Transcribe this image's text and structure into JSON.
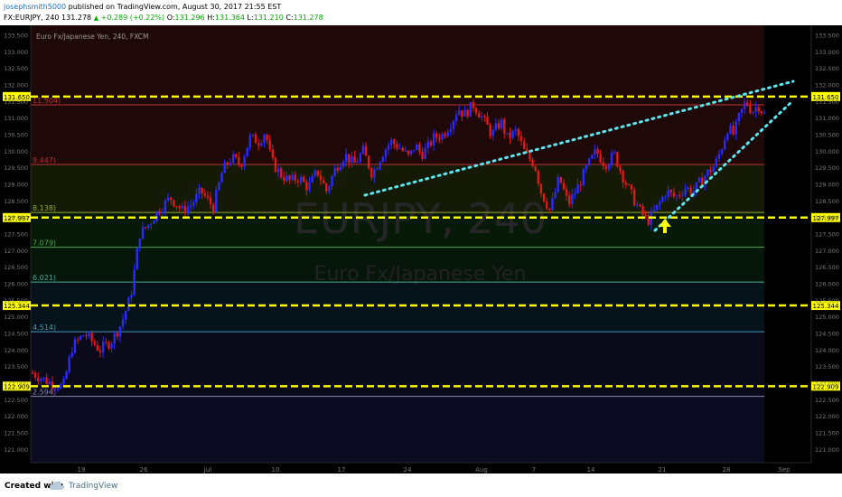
{
  "header": {
    "author": "josephsmith5000",
    "published_text": "published on TradingView.com, August 30, 2017 21:55 EST",
    "symbol": "FX:EURJPY, 240",
    "price": "131.278",
    "change": "+0.289 (+0.22%)",
    "o_label": "O:",
    "o_value": "131.296",
    "h_label": "H:",
    "h_value": "131.364",
    "l_label": "L:",
    "l_value": "131.210",
    "c_label": "C:",
    "c_value": "131.278"
  },
  "chart": {
    "title_label": "Euro Fx/Japanese Yen, 240, FXCM",
    "watermark_big": "EURJPY, 240",
    "watermark_small": "Euro Fx/Japanese Yen"
  },
  "footer": {
    "created_with": "Created with",
    "brand": "TradingView"
  },
  "colors": {
    "background": "#000000",
    "bull": "#2a2aff",
    "bear": "#e01818",
    "level_line": "#ffff00",
    "trend_line": "#5ee6f0"
  },
  "chart_data": {
    "type": "candlestick",
    "ylim": [
      120.6,
      133.8
    ],
    "y_ticks": [
      121.0,
      121.5,
      122.0,
      122.5,
      123.0,
      123.5,
      124.0,
      124.5,
      125.0,
      125.5,
      126.0,
      126.5,
      127.0,
      127.5,
      128.0,
      128.5,
      129.0,
      129.5,
      130.0,
      130.5,
      131.0,
      131.5,
      132.0,
      132.5,
      133.0,
      133.5
    ],
    "x_ticks": [
      "19",
      "26",
      "Jul",
      "10",
      "17",
      "24",
      "Aug",
      "7",
      "14",
      "21",
      "28",
      "Sep"
    ],
    "price_path": [
      [
        0,
        123.3
      ],
      [
        12,
        123.0
      ],
      [
        20,
        122.9
      ],
      [
        26,
        124.1
      ],
      [
        34,
        124.5
      ],
      [
        44,
        124.0
      ],
      [
        52,
        124.3
      ],
      [
        58,
        124.8
      ],
      [
        64,
        125.6
      ],
      [
        70,
        127.5
      ],
      [
        76,
        127.8
      ],
      [
        82,
        128.2
      ],
      [
        90,
        128.6
      ],
      [
        98,
        128.2
      ],
      [
        104,
        128.4
      ],
      [
        110,
        128.8
      ],
      [
        118,
        128.3
      ],
      [
        124,
        129.4
      ],
      [
        130,
        129.8
      ],
      [
        136,
        129.6
      ],
      [
        142,
        130.4
      ],
      [
        148,
        130.3
      ],
      [
        152,
        130.6
      ],
      [
        156,
        129.7
      ],
      [
        162,
        129.3
      ],
      [
        168,
        129.1
      ],
      [
        174,
        129.2
      ],
      [
        180,
        128.9
      ],
      [
        186,
        129.4
      ],
      [
        192,
        128.8
      ],
      [
        198,
        129.5
      ],
      [
        204,
        129.9
      ],
      [
        210,
        129.6
      ],
      [
        216,
        130.0
      ],
      [
        222,
        129.3
      ],
      [
        228,
        129.9
      ],
      [
        234,
        130.3
      ],
      [
        240,
        130.1
      ],
      [
        246,
        129.8
      ],
      [
        250,
        130.2
      ],
      [
        254,
        129.9
      ],
      [
        258,
        130.1
      ],
      [
        262,
        130.4
      ],
      [
        268,
        130.5
      ],
      [
        274,
        130.9
      ],
      [
        278,
        131.3
      ],
      [
        282,
        131.1
      ],
      [
        288,
        131.4
      ],
      [
        294,
        131.0
      ],
      [
        300,
        130.5
      ],
      [
        306,
        130.9
      ],
      [
        310,
        130.4
      ],
      [
        316,
        130.6
      ],
      [
        322,
        129.9
      ],
      [
        328,
        129.6
      ],
      [
        332,
        128.8
      ],
      [
        338,
        128.2
      ],
      [
        344,
        129.2
      ],
      [
        350,
        128.4
      ],
      [
        356,
        128.9
      ],
      [
        362,
        129.5
      ],
      [
        368,
        130.0
      ],
      [
        374,
        129.6
      ],
      [
        380,
        129.9
      ],
      [
        386,
        129.2
      ],
      [
        392,
        128.6
      ],
      [
        398,
        128.1
      ],
      [
        402,
        127.9
      ],
      [
        408,
        128.3
      ],
      [
        414,
        128.8
      ],
      [
        420,
        128.6
      ],
      [
        426,
        128.9
      ],
      [
        432,
        128.8
      ],
      [
        438,
        129.2
      ],
      [
        442,
        129.4
      ],
      [
        446,
        129.6
      ],
      [
        450,
        130.1
      ],
      [
        454,
        130.7
      ],
      [
        458,
        130.5
      ],
      [
        462,
        131.1
      ],
      [
        466,
        131.5
      ],
      [
        470,
        131.2
      ],
      [
        474,
        131.4
      ],
      [
        478,
        131.1
      ]
    ],
    "support_resistance_levels": [
      {
        "value": 131.65,
        "label": "131.650"
      },
      {
        "value": 127.997,
        "label": "127.997"
      },
      {
        "value": 125.344,
        "label": "125.344"
      },
      {
        "value": 122.909,
        "label": "122.909"
      }
    ],
    "fib_levels": [
      {
        "label": "11.504)",
        "value": 131.4
      },
      {
        "label": "9.447)",
        "value": 129.6
      },
      {
        "label": "8.138)",
        "value": 128.15
      },
      {
        "label": "7.079)",
        "value": 127.1
      },
      {
        "label": "6.021)",
        "value": 126.05
      },
      {
        "label": "4.514)",
        "value": 124.55
      },
      {
        "label": "2.594)",
        "value": 122.6
      }
    ]
  }
}
